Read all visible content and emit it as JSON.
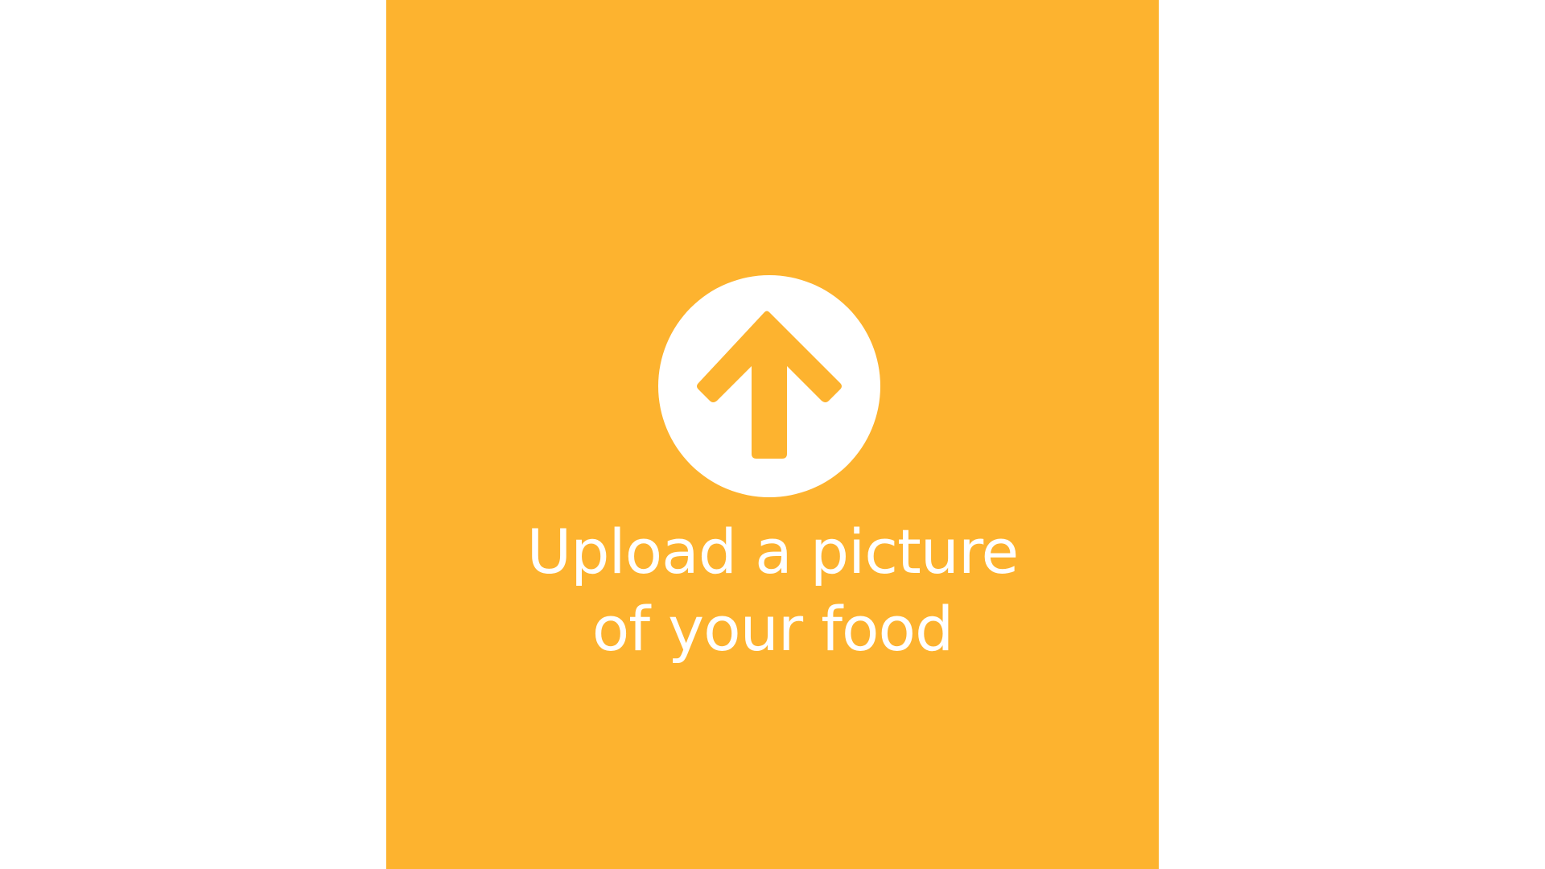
{
  "upload": {
    "line1": "Upload a picture",
    "line2": "of your food",
    "icon": "upload-arrow-icon"
  },
  "colors": {
    "panel_background": "#FDB32F",
    "icon_background": "#FFFFFF",
    "text": "#FFFFFF",
    "page_background": "#FFFFFF"
  }
}
